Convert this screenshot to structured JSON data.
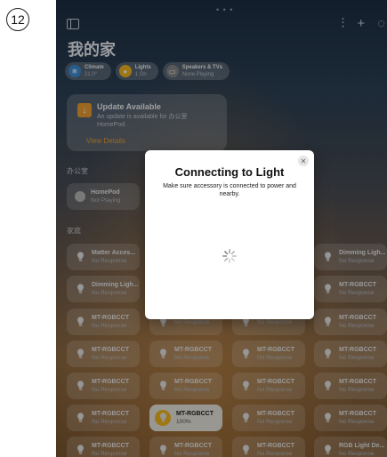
{
  "step_number": "12",
  "home": {
    "title": "我的家",
    "chips": [
      {
        "title": "Climate",
        "sub": "21.0°",
        "color": "#3b8fd9",
        "icon": "thermometer-icon"
      },
      {
        "title": "Lights",
        "sub": "1 On",
        "color": "#f5b820",
        "icon": "bulb-icon"
      },
      {
        "title": "Speakers & TVs",
        "sub": "None Playing",
        "color": "#888888",
        "icon": "speaker-icon"
      }
    ],
    "update": {
      "title": "Update Available",
      "desc": "An update is available for 办公室 HomePod.",
      "link": "View Details"
    },
    "sections": {
      "office": "办公室",
      "home": "家庭"
    },
    "homepod": {
      "name": "HomePod",
      "status": "Not Playing"
    }
  },
  "tiles": [
    {
      "name": "Matter Acces...",
      "status": "No Response"
    },
    {
      "name": "Dimming Ligh...",
      "status": "No Response"
    },
    {
      "name": "Dimming Ligh...",
      "status": "No Response"
    },
    {
      "name": "MT-RGBCCT",
      "status": "No Response"
    },
    {
      "name": "MT-RGBCCT",
      "status": "No Response"
    },
    {
      "name": "",
      "status": "No Response"
    },
    {
      "name": "",
      "status": "No Response"
    },
    {
      "name": "MT-RGBCCT",
      "status": "No Response"
    },
    {
      "name": "MT-RGBCCT",
      "status": "No Response"
    },
    {
      "name": "MT-RGBCCT",
      "status": "No Response"
    },
    {
      "name": "MT-RGBCCT",
      "status": "No Response"
    },
    {
      "name": "MT-RGBCCT",
      "status": "No Response"
    },
    {
      "name": "MT-RGBCCT",
      "status": "No Response"
    },
    {
      "name": "MT-RGBCCT",
      "status": "No Response"
    },
    {
      "name": "MT-RGBCCT",
      "status": "No Response"
    },
    {
      "name": "MT-RGBCCT",
      "status": "No Response"
    },
    {
      "name": "MT-RGBCCT",
      "status": "No Response"
    },
    {
      "name": "MT-RGBCCT",
      "status": "100%",
      "on": true
    },
    {
      "name": "MT-RGBCCT",
      "status": "No Response"
    },
    {
      "name": "MT-RGBCCT",
      "status": "No Response"
    },
    {
      "name": "MT-RGBCCT",
      "status": "No Response"
    },
    {
      "name": "MT-RGBCCT",
      "status": "No Response"
    },
    {
      "name": "MT-RGBCCT",
      "status": "No Response"
    },
    {
      "name": "RGB Light De...",
      "status": "No Response"
    }
  ],
  "modal": {
    "title": "Connecting to Light",
    "message": "Make sure accessory is connected to power and nearby.",
    "close_icon": "close-icon",
    "spinner_icon": "spinner-icon"
  }
}
